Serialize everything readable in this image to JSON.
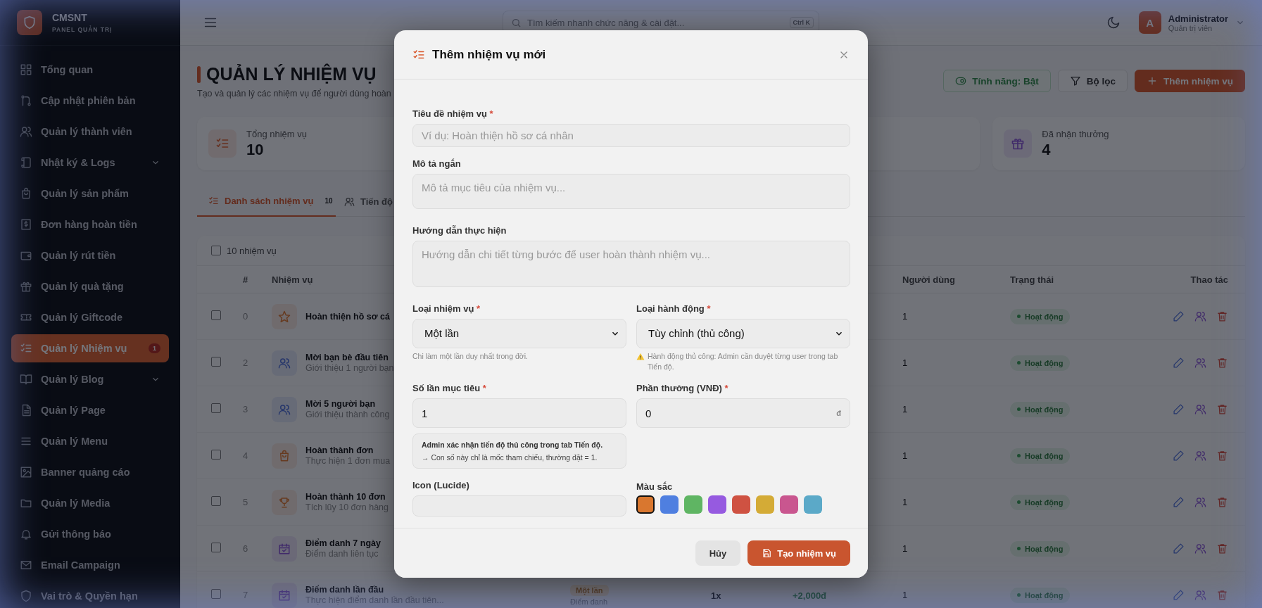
{
  "sidebar": {
    "brand": "CMSNT",
    "subtitle": "PANEL QUẢN TRỊ",
    "items": [
      {
        "label": "Tổng quan",
        "selected": false
      },
      {
        "label": "Cập nhật phiên bản",
        "selected": false
      },
      {
        "label": "Quản lý thành viên",
        "selected": false
      },
      {
        "label": "Nhật ký & Logs",
        "selected": false,
        "expanded": false
      },
      {
        "label": "Quản lý sản phẩm",
        "selected": false
      },
      {
        "label": "Đơn hàng hoàn tiền",
        "selected": false
      },
      {
        "label": "Quản lý rút tiền",
        "selected": false
      },
      {
        "label": "Quản lý quà tặng",
        "selected": false
      },
      {
        "label": "Quản lý Giftcode",
        "selected": false
      },
      {
        "label": "Quản lý Nhiệm vụ",
        "selected": true,
        "badge": "1"
      },
      {
        "label": "Quản lý Blog",
        "selected": false,
        "expanded": false
      },
      {
        "label": "Quản lý Page",
        "selected": false
      },
      {
        "label": "Quản lý Menu",
        "selected": false
      },
      {
        "label": "Banner quảng cáo",
        "selected": false
      },
      {
        "label": "Quản lý Media",
        "selected": false
      },
      {
        "label": "Gửi thông báo",
        "selected": false
      },
      {
        "label": "Email Campaign",
        "selected": false
      },
      {
        "label": "Vai trò & Quyền hạn",
        "selected": false
      }
    ]
  },
  "topbar": {
    "search_placeholder": "Tìm kiếm nhanh chức năng & cài đặt...",
    "shortcut": "Ctrl K",
    "user": {
      "initial": "A",
      "name": "Administrator",
      "role": "Quản trị viên"
    }
  },
  "page": {
    "title": "QUẢN LÝ NHIỆM VỤ",
    "subtitle": "Tạo và quản lý các nhiệm vụ để người dùng hoàn",
    "actions": [
      {
        "label": "Tính năng: Bật",
        "kind": "toggle"
      },
      {
        "label": "Bộ lọc",
        "kind": "filter"
      },
      {
        "label": "Thêm nhiệm vụ",
        "kind": "primary"
      }
    ]
  },
  "stats": [
    {
      "label": "Tổng nhiệm vụ",
      "value": "10"
    },
    {
      "label": "Đã nhận thưởng",
      "value": "4"
    }
  ],
  "tabs": [
    {
      "label": "Danh sách nhiệm vụ",
      "count": "10",
      "selected": true
    },
    {
      "label": "Tiến độ",
      "selected": false
    }
  ],
  "table": {
    "select_all": {
      "label": "10 nhiệm vụ",
      "checked": false
    },
    "columns": {
      "index": "#",
      "task": "Nhiệm vụ",
      "users": "Người dùng",
      "status": "Trạng thái",
      "actions": "Thao tác"
    },
    "rows": [
      {
        "index": "0",
        "title": "Hoàn thiện hồ sơ cá",
        "users": "1",
        "status": "Hoạt động",
        "checked": false
      },
      {
        "index": "2",
        "title": "Mời bạn bè đầu tiên",
        "desc": "Giới thiệu 1 người bạn",
        "users": "1",
        "status": "Hoạt động",
        "checked": false
      },
      {
        "index": "3",
        "title": "Mời 5 người bạn",
        "desc": "Giới thiệu thành công",
        "users": "1",
        "status": "Hoạt động",
        "checked": false
      },
      {
        "index": "4",
        "title": "Hoàn thành đơn",
        "desc": "Thực hiện 1 đơn mua",
        "users": "1",
        "status": "Hoạt động",
        "checked": false
      },
      {
        "index": "5",
        "title": "Hoàn thành 10 đơn",
        "desc": "Tích lũy 10 đơn hàng",
        "users": "1",
        "status": "Hoạt động",
        "checked": false
      },
      {
        "index": "6",
        "title": "Điểm danh 7 ngày",
        "desc": "Điểm danh liên tục",
        "users": "1",
        "status": "Hoạt động",
        "checked": false
      },
      {
        "index": "7",
        "title": "Điểm danh lần đầu",
        "desc": "Thực hiện điểm danh lần đầu tiên...",
        "type": "Một lần",
        "action": "Điểm danh",
        "target": "1x",
        "reward": "+2,000đ",
        "users": "1",
        "status": "Hoạt động",
        "checked": false
      }
    ]
  },
  "modal": {
    "title": "Thêm nhiệm vụ mới",
    "title_field": {
      "label": "Tiêu đề nhiệm vụ",
      "required_mark": "*",
      "placeholder": "Ví dụ: Hoàn thiện hồ sơ cá nhân"
    },
    "short_desc": {
      "label": "Mô tả ngắn",
      "placeholder": "Mô tả mục tiêu của nhiệm vụ..."
    },
    "guide": {
      "label": "Hướng dẫn thực hiện",
      "placeholder": "Hướng dẫn chi tiết từng bước để user hoàn thành nhiệm vụ..."
    },
    "task_type": {
      "label": "Loại nhiệm vụ",
      "required_mark": "*",
      "value": "Một lần",
      "hint": "Chi làm một lần duy nhất trong đời."
    },
    "action_type": {
      "label": "Loại hành động",
      "required_mark": "*",
      "value": "Tùy chỉnh (thủ công)",
      "warning": "Hành động thủ công: Admin cần duyệt từng user trong tab Tiến độ."
    },
    "target": {
      "label": "Số lần mục tiêu",
      "required_mark": "*",
      "value": "1",
      "note_title": "Admin xác nhận tiến độ thủ công trong tab Tiến độ.",
      "note": "→ Con số này chỉ là mốc tham chiếu, thường đặt = 1."
    },
    "reward": {
      "label": "Phần thưởng (VNĐ)",
      "required_mark": "*",
      "value": "0",
      "suffix": "đ"
    },
    "icon_field": {
      "label": "Icon (Lucide)"
    },
    "color_field": {
      "label": "Màu sắc",
      "colors": [
        {
          "color": "#d9772f",
          "selected": true
        },
        {
          "color": "#4f7fe0",
          "selected": false
        },
        {
          "color": "#5fb563",
          "selected": false
        },
        {
          "color": "#965ae0",
          "selected": false
        },
        {
          "color": "#cf5242",
          "selected": false
        },
        {
          "color": "#d4ab36",
          "selected": false
        },
        {
          "color": "#c9568f",
          "selected": false
        },
        {
          "color": "#5ba9c8",
          "selected": false
        }
      ]
    },
    "cancel": "Hủy",
    "submit": "Tạo nhiệm vụ"
  }
}
